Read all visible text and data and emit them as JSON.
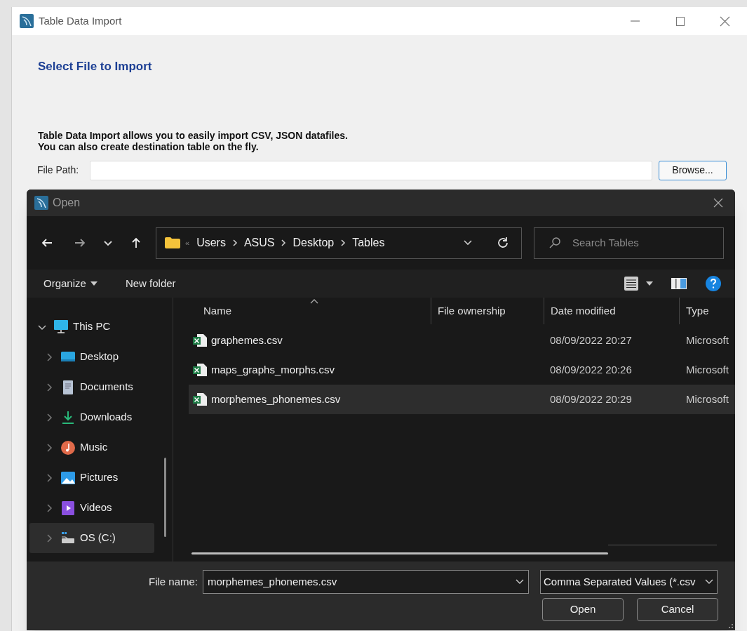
{
  "window": {
    "title": "Table Data Import"
  },
  "heading": "Select File to Import",
  "description": [
    "Table Data Import allows you to easily import CSV, JSON datafiles.",
    "You can also create destination table on the fly."
  ],
  "file_path": {
    "label": "File Path:"
  },
  "browse_button": "Browse...",
  "dialog": {
    "title": "Open",
    "address": {
      "overflow": "«",
      "segments": [
        "Users",
        "ASUS",
        "Desktop",
        "Tables"
      ]
    },
    "search": {
      "placeholder": "Search Tables"
    },
    "toolbar": {
      "organize": "Organize",
      "new_folder": "New folder"
    },
    "sidebar": {
      "items": [
        {
          "label": "This PC",
          "kind": "pc",
          "expanded": true,
          "selected": false,
          "children": [
            {
              "label": "Desktop",
              "kind": "desktop",
              "expanded": false,
              "selected": false
            },
            {
              "label": "Documents",
              "kind": "documents",
              "expanded": false,
              "selected": false
            },
            {
              "label": "Downloads",
              "kind": "downloads",
              "expanded": false,
              "selected": false
            },
            {
              "label": "Music",
              "kind": "music",
              "expanded": false,
              "selected": false
            },
            {
              "label": "Pictures",
              "kind": "pictures",
              "expanded": false,
              "selected": false
            },
            {
              "label": "Videos",
              "kind": "videos",
              "expanded": false,
              "selected": false
            },
            {
              "label": "OS (C:)",
              "kind": "drive",
              "expanded": false,
              "selected": true
            }
          ]
        }
      ]
    },
    "table": {
      "columns": [
        "Name",
        "File ownership",
        "Date modified",
        "Type"
      ],
      "rows": [
        {
          "name": "graphemes.csv",
          "date_modified": "08/09/2022 20:27",
          "type": "Microsoft",
          "selected": false
        },
        {
          "name": "maps_graphs_morphs.csv",
          "date_modified": "08/09/2022 20:26",
          "type": "Microsoft",
          "selected": false
        },
        {
          "name": "morphemes_phonemes.csv",
          "date_modified": "08/09/2022 20:29",
          "type": "Microsoft",
          "selected": true
        }
      ]
    },
    "file_name": {
      "label": "File name:",
      "value": "morphemes_phonemes.csv"
    },
    "file_type": "Comma Separated Values (*.csv",
    "buttons": [
      "Open",
      "Cancel"
    ]
  }
}
